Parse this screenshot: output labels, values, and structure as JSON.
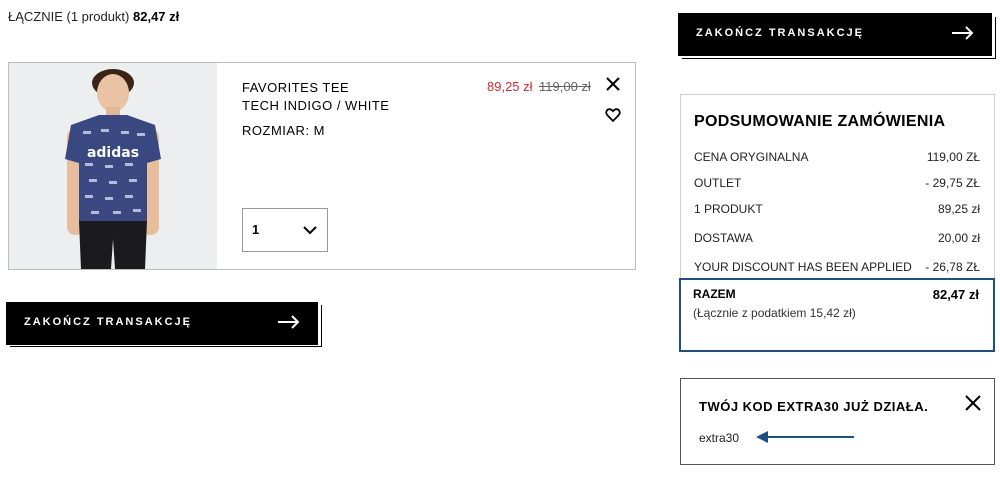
{
  "header": {
    "total_label": "ŁĄCZNIE (1 produkt)",
    "total_amount": "82,47 zł"
  },
  "cart": {
    "item": {
      "name_line1": "FAVORITES TEE",
      "name_line2": "TECH INDIGO / WHITE",
      "size": "ROZMIAR: M",
      "price_sale": "89,25 zł",
      "price_original": "119,00 zł",
      "quantity": "1",
      "shirt_logo": "adidas"
    }
  },
  "checkout": {
    "button_label": "ZAKOŃCZ TRANSAKCJĘ"
  },
  "summary": {
    "title": "PODSUMOWANIE ZAMÓWIENIA",
    "rows": [
      {
        "label": "CENA ORYGINALNA",
        "value": "119,00 ZŁ"
      },
      {
        "label": "OUTLET",
        "value": "- 29,75 ZŁ"
      },
      {
        "label": "1 PRODUKT",
        "value": "89,25 zł"
      },
      {
        "label": "DOSTAWA",
        "value": "20,00 zł"
      },
      {
        "label": "YOUR DISCOUNT HAS BEEN APPLIED",
        "value": "- 26,78 ZŁ"
      }
    ],
    "total_label": "RAZEM",
    "total_value": "82,47 zł",
    "tax_note": "(Łącznie z podatkiem  15,42 zł)"
  },
  "promo": {
    "title": "TWÓJ KOD EXTRA30 JUŻ DZIAŁA.",
    "code": "extra30"
  },
  "colors": {
    "accent_blue": "#1d4f86",
    "sale_red": "#d22b2b",
    "cta_black": "#000000"
  }
}
